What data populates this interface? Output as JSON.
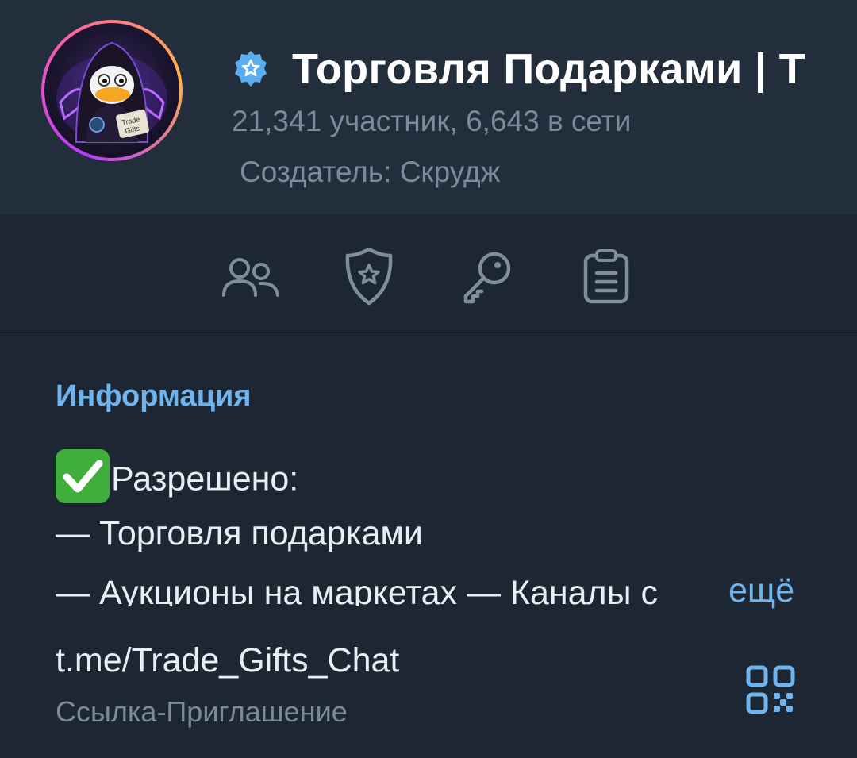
{
  "header": {
    "title": "Торговля Подарками | Т",
    "members": "21,341 участник, 6,643 в сети",
    "creator": "Создатель: Скрудж",
    "avatar_text": [
      "Trade",
      "Gifts"
    ]
  },
  "actions": [
    {
      "icon": "members-icon"
    },
    {
      "icon": "admins-shield-icon"
    },
    {
      "icon": "permissions-key-icon"
    },
    {
      "icon": "recent-actions-clipboard-icon"
    }
  ],
  "info": {
    "section_title": "Информация",
    "line1": "Разрешено:",
    "line2": "— Торговля подарками",
    "line3": "— Аукционы на маркетах — Каналы с",
    "more": "ещё",
    "link": "t.me/Trade_Gifts_Chat",
    "link_caption": "Ссылка-Приглашение"
  },
  "colors": {
    "background": "#1d2733",
    "header_background": "#232e3c",
    "accent": "#6fb4ec",
    "muted_text": "#7c8b99",
    "icon": "#7f8e9c"
  }
}
